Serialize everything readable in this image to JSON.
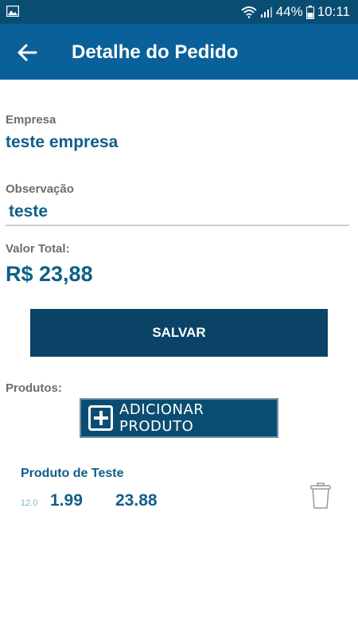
{
  "status_bar": {
    "battery_percent": "44%",
    "time": "10:11",
    "icons": [
      "gallery-icon",
      "wifi-icon",
      "signal-icon",
      "battery-icon"
    ]
  },
  "app_bar": {
    "title": "Detalhe do Pedido",
    "back_icon": "arrow-left-icon"
  },
  "form": {
    "company_label": "Empresa",
    "company_value": "teste empresa",
    "observation_label": "Observação",
    "observation_value": "teste",
    "total_label": "Valor Total:",
    "total_value": "R$ 23,88"
  },
  "actions": {
    "save_label": "SALVAR",
    "products_label": "Produtos:",
    "add_product_label": "ADICIONAR PRODUTO"
  },
  "products": [
    {
      "name": "Produto de Teste",
      "quantity": "12.0",
      "unit_price": "1.99",
      "subtotal": "23.88"
    }
  ],
  "colors": {
    "primary": "#0a6199",
    "primary_dark": "#0a4d73",
    "button": "#0a4366",
    "text_accent": "#0f5f8a"
  }
}
